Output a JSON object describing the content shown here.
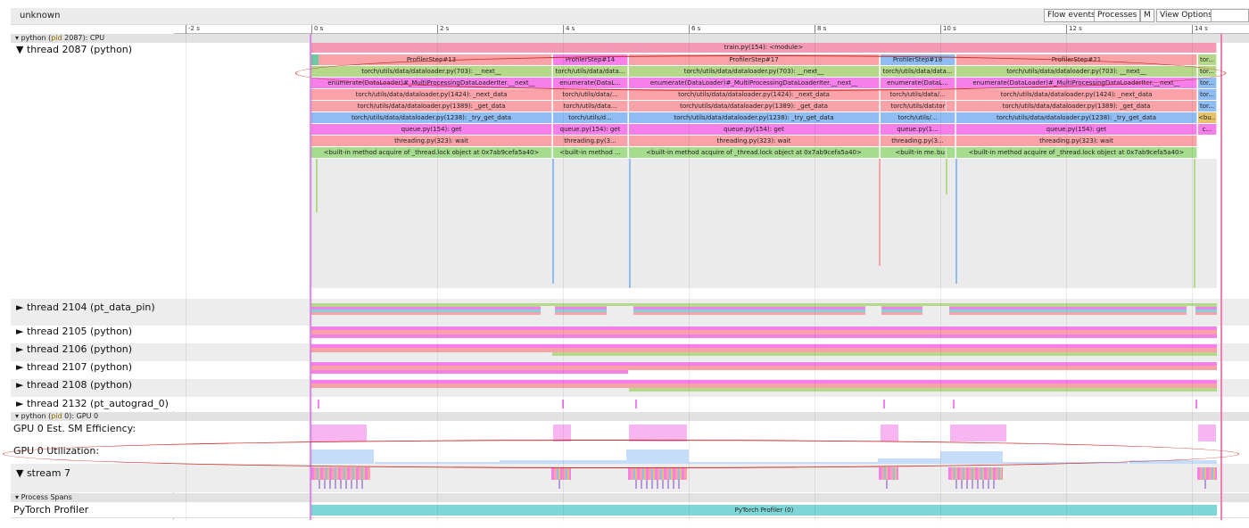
{
  "window_title": "unknown",
  "toolbar": {
    "flow_events": "Flow events",
    "processes": "Processes",
    "m": "M",
    "view_options": "View Options"
  },
  "ruler_ticks": [
    "-2 s",
    "0 s",
    "2 s",
    "4 s",
    "6 s",
    "8 s",
    "10 s",
    "12 s",
    "14 s"
  ],
  "process_cpu": {
    "arrow": "▾",
    "prefix": "python (",
    "pid_word": "pid",
    "suffix": " 2087): CPU"
  },
  "process_gpu": {
    "arrow": "▾",
    "prefix": "python (",
    "pid_word": "pid",
    "suffix": " 0): GPU 0"
  },
  "process_spans": {
    "arrow": "▾",
    "label": "Process Spans"
  },
  "threads": [
    "▼  thread 2087 (python)",
    "►  thread 2104 (pt_data_pin)",
    "►  thread 2105 (python)",
    "►  thread 2106 (python)",
    "►  thread 2107 (python)",
    "►  thread 2108 (python)",
    "►  thread 2132 (pt_autograd_0)"
  ],
  "gpu_tracks": {
    "sm_efficiency": "GPU 0 Est. SM Efficiency:",
    "utilization": "GPU 0 Utilization:",
    "stream": "▼  stream 7"
  },
  "pytorch_profiler": {
    "label": "PyTorch Profiler",
    "bar": "PyTorch Profiler (0)"
  },
  "flame": {
    "root": "train.py(154): <module>",
    "rows": [
      [
        "ProfilerStep#13",
        "ProfilerStep#14",
        "ProfilerStep#17",
        "ProfilerStep#18",
        "ProfilerStep#21",
        "tor..."
      ],
      [
        "torch/utils/data/dataloader.py(703): __next__",
        "torch/utils/data/data...",
        "torch/utils/data/dataloader.py(703): __next__",
        "torch/utils/data/data...",
        "torch/utils/data/dataloader.py(703): __next__",
        "tor..."
      ],
      [
        "enumerate(DataLoader)#_MultiProcessingDataLoaderIter.__next__",
        "enumerate(DataL...",
        "enumerate(DataLoader)#_MultiProcessingDataLoaderIter.__next__",
        "enumerate(DataL...",
        "enumerate(DataLoader)#_MultiProcessingDataLoaderIter.__next__",
        "tor..."
      ],
      [
        "torch/utils/data/dataloader.py(1424): _next_data",
        "torch/utils/data/...",
        "torch/utils/data/dataloader.py(1424): _next_data",
        "torch/utils/data/...",
        "torch/utils/data/dataloader.py(1424): _next_data",
        "tor..."
      ],
      [
        "torch/utils/data/dataloader.py(1389): _get_data",
        "torch/utils/data...",
        "torch/utils/data/dataloader.py(1389): _get_data",
        "torch/utils/data...",
        "torch/utils/data/dataloader.py(1389): _get_data",
        "tor..."
      ],
      [
        "torch/utils/data/dataloader.py(1238): _try_get_data",
        "torch/utils/d...",
        "torch/utils/data/dataloader.py(1238): _try_get_data",
        "torch/utils/...",
        "torch/utils/data/dataloader.py(1238): _try_get_data",
        "<bu..."
      ],
      [
        "queue.py(154): get",
        "queue.py(154): get",
        "queue.py(154): get",
        "queue.py(1...",
        "queue.py(154): get",
        "c..."
      ],
      [
        "threading.py(323): wait",
        "threading.py(3...",
        "threading.py(323): wait",
        "threading.py(3...",
        "threading.py(323): wait",
        ""
      ],
      [
        "<built-in method acquire of _thread.lock object at 0x7ab9cefa5a40>",
        "<built-in method ...",
        "<built-in method acquire of _thread.lock object at 0x7ab9cefa5a40>",
        "<built-in me...",
        "<built-in method acquire of _thread.lock object at 0x7ab9cefa5a40>",
        ""
      ]
    ],
    "extra_labels": {
      "tor": "tor",
      "bu": "bu"
    },
    "colors": [
      "#f59ab4",
      "#b6d88b",
      "#f77fe9",
      "#f9a3a8",
      "#f9a3a8",
      "#8fbcf2",
      "#f77fe9",
      "#f9a3a8",
      "#a6dc8d"
    ]
  }
}
